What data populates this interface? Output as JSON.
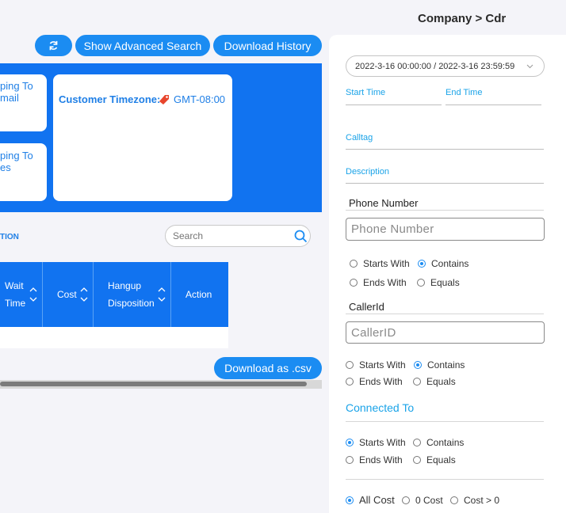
{
  "header": {
    "breadcrumb": "Company > Cdr"
  },
  "toolbar": {
    "refresh_icon": "refresh-icon",
    "advanced_search_label": "Show Advanced Search",
    "download_history_label": "Download History"
  },
  "banner": {
    "card1_line1": "ping To",
    "card1_line2": "mail",
    "card2_line1": "ping To",
    "card2_line2": "es",
    "timezone_label": "Customer Timezone:",
    "timezone_icon": "tag-icon",
    "timezone_value": "GMT-08:00"
  },
  "table": {
    "section_label": "TION",
    "search_placeholder": "Search",
    "columns": [
      {
        "line1": "Wait",
        "line2": "Time"
      },
      {
        "line1": "Cost",
        "line2": ""
      },
      {
        "line1": "Hangup",
        "line2": "Disposition"
      },
      {
        "line1": "Action",
        "line2": ""
      }
    ],
    "download_csv_label": "Download as .csv"
  },
  "filters": {
    "date_range": "2022-3-16 00:00:00 / 2022-3-16 23:59:59",
    "start_time_label": "Start Time",
    "end_time_label": "End Time",
    "calltag_label": "Calltag",
    "description_label": "Description",
    "phone_number_label": "Phone Number",
    "phone_number_placeholder": "Phone Number",
    "phone_options": {
      "starts_with": "Starts With",
      "contains": "Contains",
      "ends_with": "Ends With",
      "equals": "Equals",
      "selected": "Contains"
    },
    "caller_id_label": "CallerId",
    "caller_id_placeholder": "CallerID",
    "caller_options": {
      "starts_with": "Starts With",
      "contains": "Contains",
      "ends_with": "Ends With",
      "equals": "Equals",
      "selected": "Contains"
    },
    "connected_to_label": "Connected To",
    "connected_options": {
      "starts_with": "Starts With",
      "contains": "Contains",
      "ends_with": "Ends With",
      "equals": "Equals",
      "selected": "Starts With"
    },
    "cost_options": {
      "all": "All Cost",
      "zero": "0 Cost",
      "gt_zero": "Cost > 0",
      "selected": "All Cost"
    }
  },
  "colors": {
    "accent": "#1b8cf2",
    "banner": "#1173f0",
    "label_blue": "#1aa3e8"
  }
}
